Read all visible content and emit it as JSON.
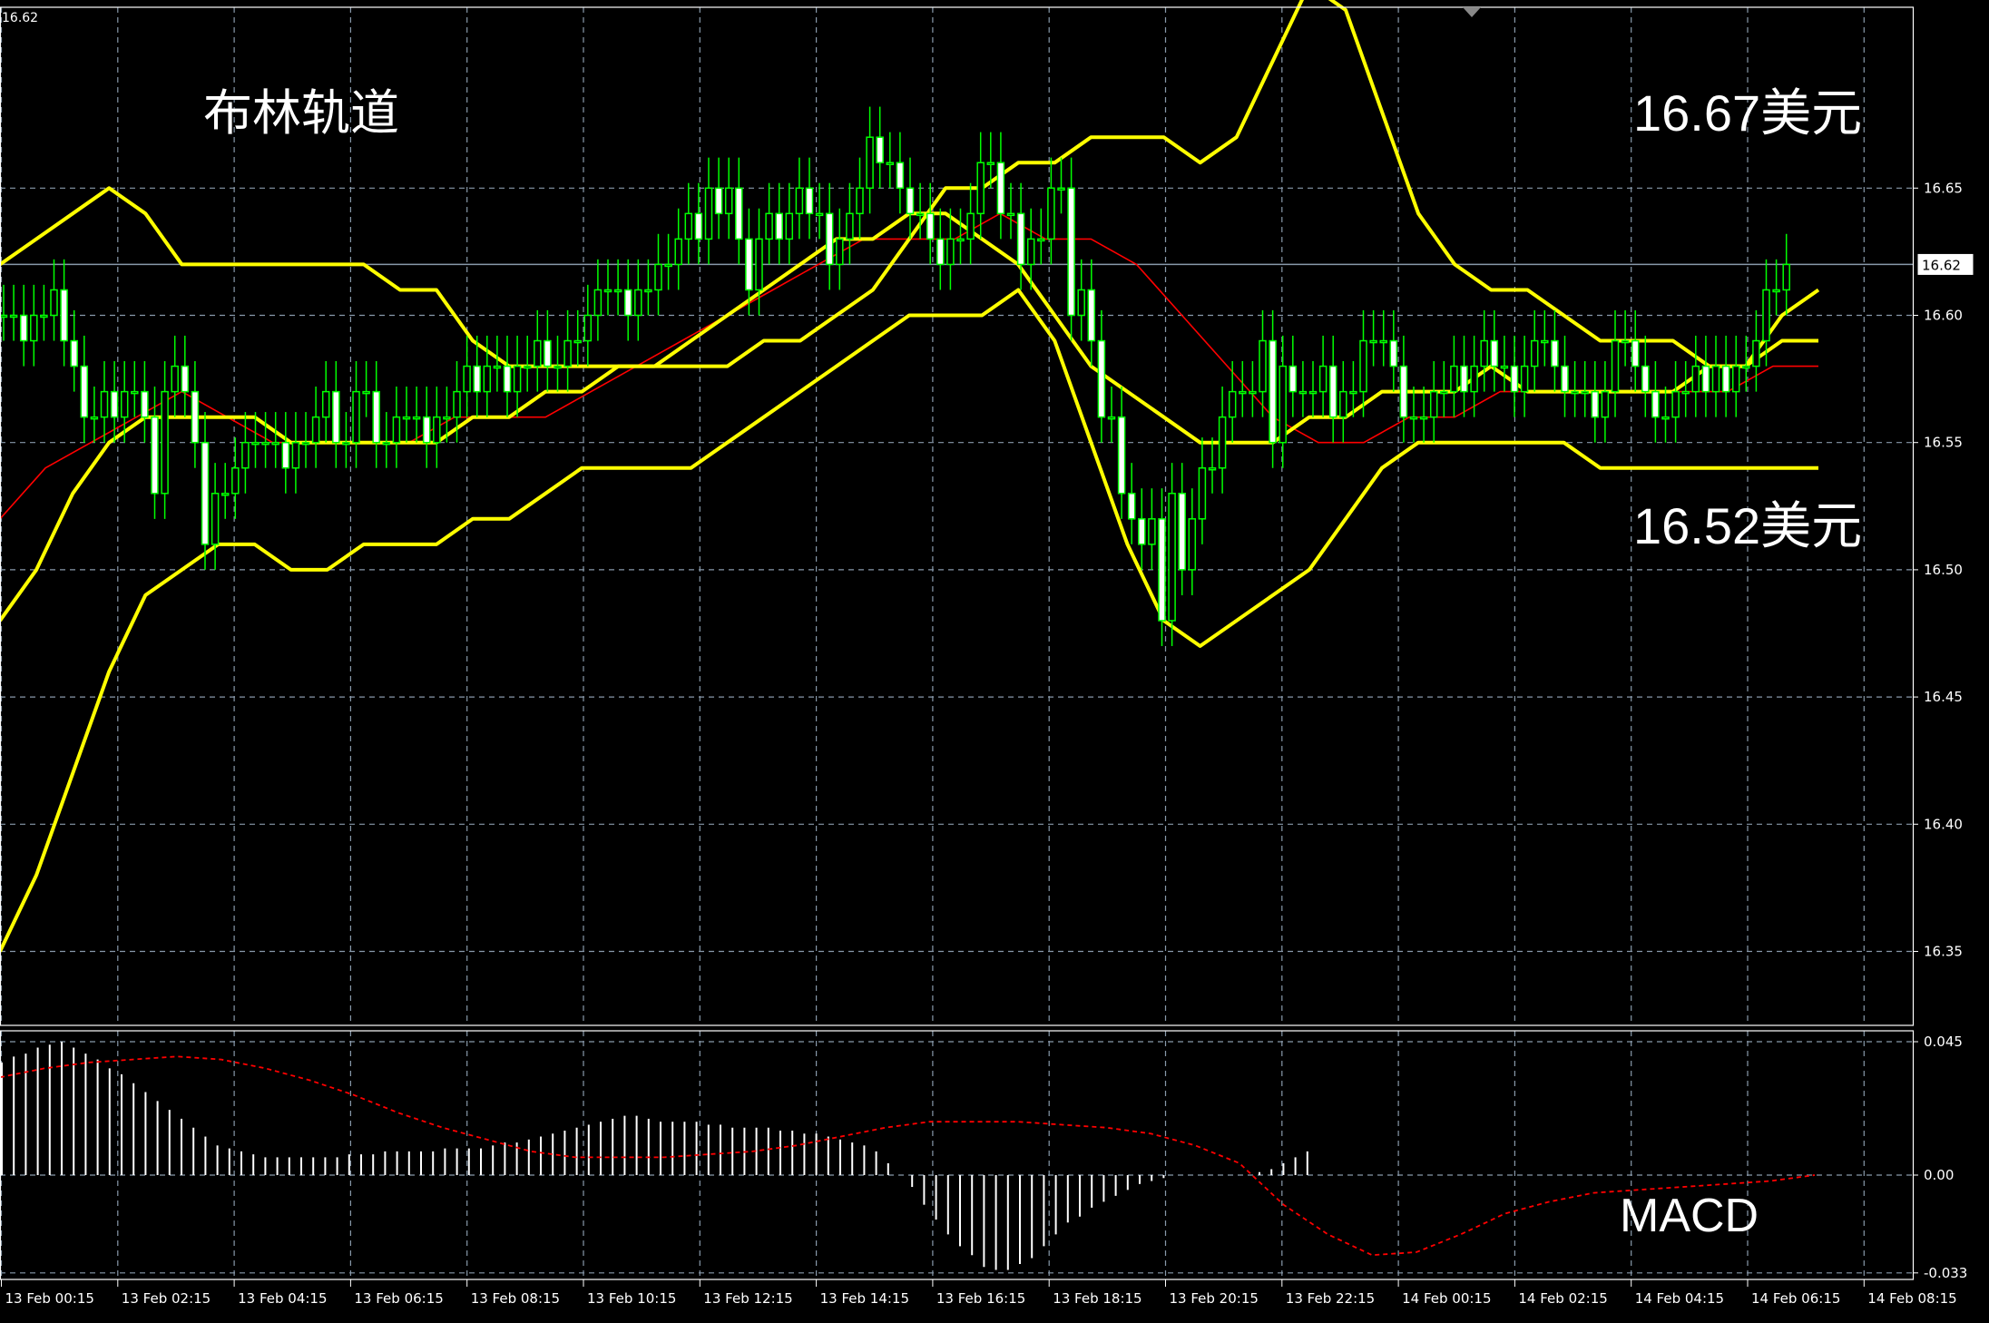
{
  "chart_data": [
    {
      "type": "candlestick",
      "title": "布林轨道",
      "corner_price": "16.62",
      "current_price": "16.62",
      "ylim": [
        16.3,
        16.7
      ],
      "yticks": [
        "16.65",
        "16.60",
        "16.55",
        "16.50",
        "16.45",
        "16.40",
        "16.35"
      ],
      "ytick_values": [
        16.65,
        16.6,
        16.55,
        16.5,
        16.45,
        16.4,
        16.35
      ],
      "x_labels": [
        "13 Feb 00:15",
        "13 Feb 02:15",
        "13 Feb 04:15",
        "13 Feb 06:15",
        "13 Feb 08:15",
        "13 Feb 10:15",
        "13 Feb 12:15",
        "13 Feb 14:15",
        "13 Feb 16:15",
        "13 Feb 18:15",
        "13 Feb 20:15",
        "13 Feb 22:15",
        "14 Feb 00:15",
        "14 Feb 02:15",
        "14 Feb 04:15",
        "14 Feb 06:15",
        "14 Feb 08:15"
      ],
      "annotations": {
        "upper": "16.67美元",
        "lower": "16.52美元"
      },
      "close": [
        16.6,
        16.6,
        16.59,
        16.6,
        16.6,
        16.61,
        16.59,
        16.58,
        16.56,
        16.56,
        16.57,
        16.56,
        16.57,
        16.57,
        16.56,
        16.53,
        16.57,
        16.58,
        16.57,
        16.55,
        16.51,
        16.53,
        16.53,
        16.54,
        16.55,
        16.55,
        16.55,
        16.55,
        16.54,
        16.55,
        16.55,
        16.56,
        16.57,
        16.55,
        16.55,
        16.57,
        16.57,
        16.55,
        16.55,
        16.56,
        16.56,
        16.56,
        16.55,
        16.56,
        16.56,
        16.57,
        16.58,
        16.57,
        16.58,
        16.58,
        16.57,
        16.58,
        16.58,
        16.59,
        16.58,
        16.58,
        16.59,
        16.59,
        16.6,
        16.61,
        16.61,
        16.61,
        16.6,
        16.61,
        16.61,
        16.62,
        16.62,
        16.63,
        16.64,
        16.63,
        16.65,
        16.64,
        16.65,
        16.63,
        16.61,
        16.63,
        16.64,
        16.63,
        16.64,
        16.65,
        16.64,
        16.64,
        16.62,
        16.63,
        16.64,
        16.65,
        16.67,
        16.66,
        16.66,
        16.65,
        16.64,
        16.64,
        16.63,
        16.62,
        16.63,
        16.63,
        16.64,
        16.66,
        16.66,
        16.64,
        16.64,
        16.62,
        16.63,
        16.63,
        16.65,
        16.65,
        16.6,
        16.61,
        16.59,
        16.56,
        16.56,
        16.53,
        16.52,
        16.51,
        16.52,
        16.48,
        16.53,
        16.5,
        16.52,
        16.54,
        16.54,
        16.56,
        16.57,
        16.57,
        16.57,
        16.59,
        16.55,
        16.58,
        16.57,
        16.57,
        16.57,
        16.58,
        16.56,
        16.57,
        16.57,
        16.59,
        16.59,
        16.59,
        16.58,
        16.56,
        16.56,
        16.56,
        16.57,
        16.57,
        16.58,
        16.57,
        16.58,
        16.59,
        16.58,
        16.58,
        16.57,
        16.58,
        16.59,
        16.59,
        16.58,
        16.57,
        16.57,
        16.57,
        16.56,
        16.57,
        16.59,
        16.59,
        16.58,
        16.57,
        16.56,
        16.56,
        16.57,
        16.57,
        16.58,
        16.57,
        16.58,
        16.57,
        16.58,
        16.58,
        16.59,
        16.61,
        16.61,
        16.62
      ],
      "bollinger": {
        "upper": [
          16.62,
          16.63,
          16.64,
          16.65,
          16.64,
          16.62,
          16.62,
          16.62,
          16.62,
          16.62,
          16.62,
          16.61,
          16.61,
          16.59,
          16.58,
          16.58,
          16.58,
          16.58,
          16.58,
          16.58,
          16.58,
          16.59,
          16.59,
          16.6,
          16.61,
          16.63,
          16.65,
          16.65,
          16.66,
          16.66,
          16.67,
          16.67,
          16.67,
          16.66,
          16.67,
          16.7,
          16.73,
          16.72,
          16.68,
          16.64,
          16.62,
          16.61,
          16.61,
          16.6,
          16.59,
          16.59,
          16.59,
          16.58,
          16.58,
          16.6,
          16.61
        ],
        "middle": [
          16.48,
          16.5,
          16.53,
          16.55,
          16.56,
          16.56,
          16.56,
          16.56,
          16.55,
          16.55,
          16.55,
          16.55,
          16.55,
          16.56,
          16.56,
          16.57,
          16.57,
          16.58,
          16.58,
          16.59,
          16.6,
          16.61,
          16.62,
          16.63,
          16.63,
          16.64,
          16.64,
          16.63,
          16.62,
          16.6,
          16.58,
          16.57,
          16.56,
          16.55,
          16.55,
          16.55,
          16.56,
          16.56,
          16.57,
          16.57,
          16.57,
          16.58,
          16.57,
          16.57,
          16.57,
          16.57,
          16.57,
          16.58,
          16.58,
          16.59,
          16.59
        ],
        "lower": [
          16.35,
          16.38,
          16.42,
          16.46,
          16.49,
          16.5,
          16.51,
          16.51,
          16.5,
          16.5,
          16.51,
          16.51,
          16.51,
          16.52,
          16.52,
          16.53,
          16.54,
          16.54,
          16.54,
          16.54,
          16.55,
          16.56,
          16.57,
          16.58,
          16.59,
          16.6,
          16.6,
          16.6,
          16.61,
          16.59,
          16.55,
          16.51,
          16.48,
          16.47,
          16.48,
          16.49,
          16.5,
          16.52,
          16.54,
          16.55,
          16.55,
          16.55,
          16.55,
          16.55,
          16.54,
          16.54,
          16.54,
          16.54,
          16.54,
          16.54,
          16.54
        ]
      },
      "ma": [
        16.52,
        16.54,
        16.55,
        16.56,
        16.57,
        16.56,
        16.55,
        16.55,
        16.55,
        16.55,
        16.56,
        16.56,
        16.56,
        16.57,
        16.58,
        16.59,
        16.6,
        16.61,
        16.62,
        16.63,
        16.63,
        16.63,
        16.64,
        16.63,
        16.63,
        16.62,
        16.6,
        16.58,
        16.56,
        16.55,
        16.55,
        16.56,
        16.56,
        16.57,
        16.57,
        16.57,
        16.57,
        16.57,
        16.57,
        16.58,
        16.58
      ],
      "colors": {
        "candle": "#00ff00",
        "bull_fill": "#000000",
        "bear_fill": "#ffffff",
        "bands": "#ffff00",
        "ma": "#ff0000",
        "grid": "#8899aa",
        "price_line": "#8899aa"
      }
    },
    {
      "type": "bar",
      "title": "MACD",
      "ylim": [
        -0.033,
        0.045
      ],
      "yticks": [
        "0.045",
        "0.00",
        "-0.033"
      ],
      "ytick_values": [
        0.045,
        0.0,
        -0.033
      ],
      "histogram": [
        0.038,
        0.04,
        0.041,
        0.043,
        0.044,
        0.045,
        0.043,
        0.041,
        0.039,
        0.036,
        0.034,
        0.031,
        0.028,
        0.025,
        0.022,
        0.019,
        0.016,
        0.013,
        0.01,
        0.009,
        0.008,
        0.007,
        0.006,
        0.006,
        0.006,
        0.006,
        0.006,
        0.006,
        0.006,
        0.007,
        0.007,
        0.007,
        0.008,
        0.008,
        0.008,
        0.008,
        0.008,
        0.009,
        0.009,
        0.009,
        0.009,
        0.01,
        0.011,
        0.011,
        0.012,
        0.013,
        0.014,
        0.015,
        0.016,
        0.017,
        0.018,
        0.019,
        0.02,
        0.02,
        0.019,
        0.018,
        0.018,
        0.018,
        0.018,
        0.017,
        0.017,
        0.016,
        0.016,
        0.016,
        0.016,
        0.015,
        0.015,
        0.014,
        0.014,
        0.013,
        0.012,
        0.011,
        0.01,
        0.008,
        0.004,
        0.0,
        -0.004,
        -0.01,
        -0.015,
        -0.02,
        -0.024,
        -0.027,
        -0.031,
        -0.032,
        -0.032,
        -0.03,
        -0.028,
        -0.024,
        -0.02,
        -0.016,
        -0.014,
        -0.011,
        -0.009,
        -0.007,
        -0.005,
        -0.003,
        -0.002,
        -0.001,
        0.0,
        0.0,
        0.0,
        0.0,
        0.0,
        0.0,
        0.0,
        0.001,
        0.002,
        0.004,
        0.006,
        0.008
      ],
      "signal": [
        0.033,
        0.036,
        0.038,
        0.039,
        0.04,
        0.039,
        0.036,
        0.032,
        0.027,
        0.021,
        0.016,
        0.012,
        0.008,
        0.006,
        0.006,
        0.006,
        0.007,
        0.008,
        0.01,
        0.013,
        0.016,
        0.018,
        0.018,
        0.018,
        0.017,
        0.016,
        0.014,
        0.01,
        0.004,
        -0.01,
        -0.02,
        -0.027,
        -0.026,
        -0.02,
        -0.013,
        -0.009,
        -0.006,
        -0.005,
        -0.004,
        -0.003,
        -0.002,
        0.0
      ],
      "colors": {
        "histogram": "#ffffff",
        "signal": "#ff0000"
      }
    }
  ]
}
